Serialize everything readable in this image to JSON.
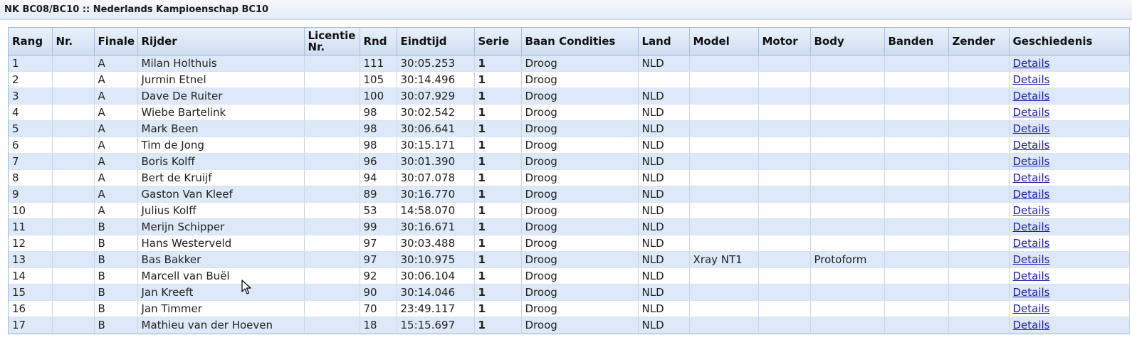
{
  "page": {
    "title": "NK BC08/BC10 :: Nederlands Kampioenschap BC10"
  },
  "columns": [
    "Rang",
    "Nr.",
    "Finale",
    "Rijder",
    "Licentie Nr.",
    "Rnd",
    "Eindtijd",
    "Serie",
    "Baan Condities",
    "Land",
    "Model",
    "Motor",
    "Body",
    "Banden",
    "Zender",
    "Geschiedenis"
  ],
  "rows": [
    {
      "rang": "1",
      "nr": "",
      "finale": "A",
      "rijder": "Milan Holthuis",
      "licentie": "",
      "rnd": "111",
      "eindtijd": "30:05.253",
      "serie": "1",
      "baan": "Droog",
      "land": "NLD",
      "model": "",
      "motor": "",
      "body": "",
      "banden": "",
      "zender": "",
      "details": "Details"
    },
    {
      "rang": "2",
      "nr": "",
      "finale": "A",
      "rijder": "Jurmin Etnel",
      "licentie": "",
      "rnd": "105",
      "eindtijd": "30:14.496",
      "serie": "1",
      "baan": "Droog",
      "land": "",
      "model": "",
      "motor": "",
      "body": "",
      "banden": "",
      "zender": "",
      "details": "Details"
    },
    {
      "rang": "3",
      "nr": "",
      "finale": "A",
      "rijder": "Dave De Ruiter",
      "licentie": "",
      "rnd": "100",
      "eindtijd": "30:07.929",
      "serie": "1",
      "baan": "Droog",
      "land": "NLD",
      "model": "",
      "motor": "",
      "body": "",
      "banden": "",
      "zender": "",
      "details": "Details"
    },
    {
      "rang": "4",
      "nr": "",
      "finale": "A",
      "rijder": "Wiebe Bartelink",
      "licentie": "",
      "rnd": "98",
      "eindtijd": "30:02.542",
      "serie": "1",
      "baan": "Droog",
      "land": "NLD",
      "model": "",
      "motor": "",
      "body": "",
      "banden": "",
      "zender": "",
      "details": "Details"
    },
    {
      "rang": "5",
      "nr": "",
      "finale": "A",
      "rijder": "Mark Been",
      "licentie": "",
      "rnd": "98",
      "eindtijd": "30:06.641",
      "serie": "1",
      "baan": "Droog",
      "land": "NLD",
      "model": "",
      "motor": "",
      "body": "",
      "banden": "",
      "zender": "",
      "details": "Details"
    },
    {
      "rang": "6",
      "nr": "",
      "finale": "A",
      "rijder": "Tim de Jong",
      "licentie": "",
      "rnd": "98",
      "eindtijd": "30:15.171",
      "serie": "1",
      "baan": "Droog",
      "land": "NLD",
      "model": "",
      "motor": "",
      "body": "",
      "banden": "",
      "zender": "",
      "details": "Details"
    },
    {
      "rang": "7",
      "nr": "",
      "finale": "A",
      "rijder": "Boris Kolff",
      "licentie": "",
      "rnd": "96",
      "eindtijd": "30:01.390",
      "serie": "1",
      "baan": "Droog",
      "land": "NLD",
      "model": "",
      "motor": "",
      "body": "",
      "banden": "",
      "zender": "",
      "details": "Details"
    },
    {
      "rang": "8",
      "nr": "",
      "finale": "A",
      "rijder": "Bert de Kruijf",
      "licentie": "",
      "rnd": "94",
      "eindtijd": "30:07.078",
      "serie": "1",
      "baan": "Droog",
      "land": "NLD",
      "model": "",
      "motor": "",
      "body": "",
      "banden": "",
      "zender": "",
      "details": "Details"
    },
    {
      "rang": "9",
      "nr": "",
      "finale": "A",
      "rijder": "Gaston Van Kleef",
      "licentie": "",
      "rnd": "89",
      "eindtijd": "30:16.770",
      "serie": "1",
      "baan": "Droog",
      "land": "NLD",
      "model": "",
      "motor": "",
      "body": "",
      "banden": "",
      "zender": "",
      "details": "Details"
    },
    {
      "rang": "10",
      "nr": "",
      "finale": "A",
      "rijder": "Julius Kolff",
      "licentie": "",
      "rnd": "53",
      "eindtijd": "14:58.070",
      "serie": "1",
      "baan": "Droog",
      "land": "NLD",
      "model": "",
      "motor": "",
      "body": "",
      "banden": "",
      "zender": "",
      "details": "Details"
    },
    {
      "rang": "11",
      "nr": "",
      "finale": "B",
      "rijder": "Merijn Schipper",
      "licentie": "",
      "rnd": "99",
      "eindtijd": "30:16.671",
      "serie": "1",
      "baan": "Droog",
      "land": "NLD",
      "model": "",
      "motor": "",
      "body": "",
      "banden": "",
      "zender": "",
      "details": "Details"
    },
    {
      "rang": "12",
      "nr": "",
      "finale": "B",
      "rijder": "Hans Westerveld",
      "licentie": "",
      "rnd": "97",
      "eindtijd": "30:03.488",
      "serie": "1",
      "baan": "Droog",
      "land": "NLD",
      "model": "",
      "motor": "",
      "body": "",
      "banden": "",
      "zender": "",
      "details": "Details"
    },
    {
      "rang": "13",
      "nr": "",
      "finale": "B",
      "rijder": "Bas Bakker",
      "licentie": "",
      "rnd": "97",
      "eindtijd": "30:10.975",
      "serie": "1",
      "baan": "Droog",
      "land": "NLD",
      "model": "Xray NT1",
      "motor": "",
      "body": "Protoform",
      "banden": "",
      "zender": "",
      "details": "Details"
    },
    {
      "rang": "14",
      "nr": "",
      "finale": "B",
      "rijder": "Marcell van Buël",
      "licentie": "",
      "rnd": "92",
      "eindtijd": "30:06.104",
      "serie": "1",
      "baan": "Droog",
      "land": "NLD",
      "model": "",
      "motor": "",
      "body": "",
      "banden": "",
      "zender": "",
      "details": "Details"
    },
    {
      "rang": "15",
      "nr": "",
      "finale": "B",
      "rijder": "Jan Kreeft",
      "licentie": "",
      "rnd": "90",
      "eindtijd": "30:14.046",
      "serie": "1",
      "baan": "Droog",
      "land": "NLD",
      "model": "",
      "motor": "",
      "body": "",
      "banden": "",
      "zender": "",
      "details": "Details"
    },
    {
      "rang": "16",
      "nr": "",
      "finale": "B",
      "rijder": "Jan Timmer",
      "licentie": "",
      "rnd": "70",
      "eindtijd": "23:49.117",
      "serie": "1",
      "baan": "Droog",
      "land": "NLD",
      "model": "",
      "motor": "",
      "body": "",
      "banden": "",
      "zender": "",
      "details": "Details"
    },
    {
      "rang": "17",
      "nr": "",
      "finale": "B",
      "rijder": "Mathieu van der Hoeven",
      "licentie": "",
      "rnd": "18",
      "eindtijd": "15:15.697",
      "serie": "1",
      "baan": "Droog",
      "land": "NLD",
      "model": "",
      "motor": "",
      "body": "",
      "banden": "",
      "zender": "",
      "details": "Details"
    }
  ],
  "colors": {
    "header_gradient_top": "#eaf1fb",
    "header_gradient_bottom": "#cfdef2",
    "row_alt": "#dde9f8",
    "row": "#ffffff",
    "link": "#1c1ca8"
  },
  "icons": {
    "cursor": "mouse-pointer-icon"
  }
}
